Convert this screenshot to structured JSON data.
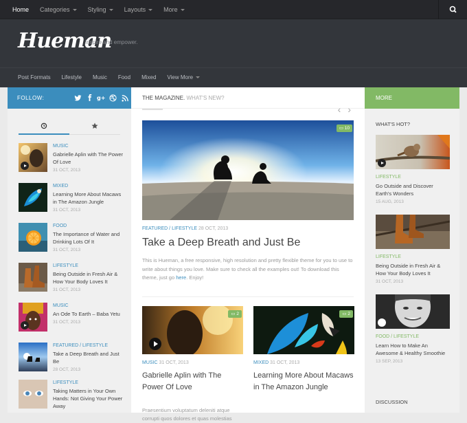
{
  "topnav": {
    "items": [
      {
        "label": "Home",
        "caret": false,
        "active": true
      },
      {
        "label": "Categories",
        "caret": true
      },
      {
        "label": "Styling",
        "caret": true
      },
      {
        "label": "Layouts",
        "caret": true
      },
      {
        "label": "More",
        "caret": true
      }
    ],
    "search_icon": "search-icon"
  },
  "header": {
    "logo": "Hueman",
    "tagline": "Inspire and empower."
  },
  "subnav": {
    "items": [
      "Post Formats",
      "Lifestyle",
      "Music",
      "Food",
      "Mixed",
      "View More"
    ]
  },
  "follow": {
    "label": "FOLLOW:",
    "icons": [
      "twitter-icon",
      "facebook-icon",
      "google-plus-icon",
      "dribbble-icon",
      "rss-icon"
    ]
  },
  "magazine": {
    "title": "THE MAGAZINE.",
    "subtitle": "WHAT'S NEW?"
  },
  "more_label": "MORE",
  "colors": {
    "blue": "#3b8dbd",
    "green": "#82b965",
    "dark": "#33363b"
  },
  "left_tabs": [
    "clock-icon",
    "star-icon"
  ],
  "left_posts": [
    {
      "category": "MUSIC",
      "title": "Gabrielle Aplin with The Power Of Love",
      "date": "31 OCT, 2013"
    },
    {
      "category": "MIXED",
      "title": "Learning More About Macaws in The Amazon Jungle",
      "date": "31 OCT, 2013"
    },
    {
      "category": "FOOD",
      "title": "The Importance of Water and Drinking Lots Of It",
      "date": "31 OCT, 2013"
    },
    {
      "category": "LIFESTYLE",
      "title": "Being Outside in Fresh Air & How Your Body Loves It",
      "date": "31 OCT, 2013"
    },
    {
      "category": "MUSIC",
      "title": "An Ode To Earth – Baba Yetu",
      "date": "31 OCT, 2013"
    },
    {
      "category": "FEATURED / LIFESTYLE",
      "title": "Take a Deep Breath and Just Be",
      "date": "28 OCT, 2013"
    },
    {
      "category": "LIFESTYLE",
      "title": "Taking Matters in Your Own Hands: Not Giving Your Power Away",
      "date": ""
    }
  ],
  "featured": {
    "comments": "10",
    "cat1": "FEATURED",
    "sep": "/",
    "cat2": "LIFESTYLE",
    "date": "28 OCT, 2013",
    "title": "Take a Deep Breath and Just Be",
    "excerpt_before": "This is Hueman, a free responsive, high resolution and pretty flexible theme for you to use to write about things you love. Make sure to check all the examples out! To download this theme, just go ",
    "excerpt_link": "here",
    "excerpt_after": ". Enjoy!"
  },
  "cards": [
    {
      "comments": "2",
      "category": "MUSIC",
      "date": "31 OCT, 2013",
      "title": "Gabrielle Aplin with The Power Of Love",
      "excerpt": "Praesentium voluptatum deleniti atque corrupti quos dolores et quas molestias"
    },
    {
      "comments": "2",
      "category": "MIXED",
      "date": "31 OCT, 2013",
      "title": "Learning More About Macaws in The Amazon Jungle",
      "excerpt": ""
    }
  ],
  "right": {
    "heading": "WHAT'S HOT?",
    "posts": [
      {
        "category": "LIFESTYLE",
        "title": "Go Outside and Discover Earth's Wonders",
        "date": "15 AUG, 2013"
      },
      {
        "category": "LIFESTYLE",
        "title": "Being Outside in Fresh Air & How Your Body Loves It",
        "date": "31 OCT, 2013"
      },
      {
        "category": "FOOD / LIFESTYLE",
        "title": "Learn How to Make An Awesome & Healthy Smoothie",
        "date": "13 SEP, 2013"
      }
    ],
    "discussion": "DISCUSSION"
  }
}
